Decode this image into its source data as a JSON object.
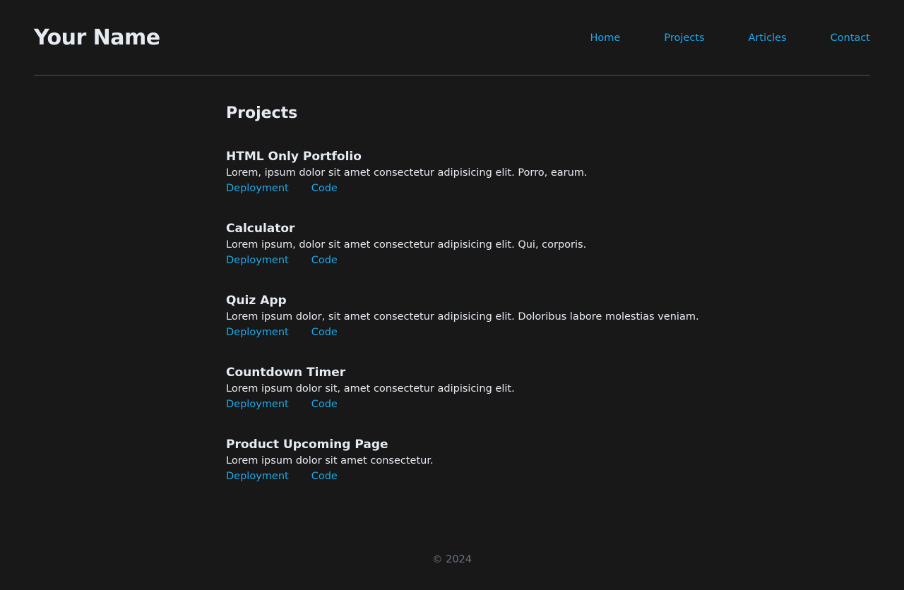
{
  "header": {
    "title": "Your Name",
    "nav": [
      "Home",
      "Projects",
      "Articles",
      "Contact"
    ]
  },
  "main": {
    "section_title": "Projects",
    "projects": [
      {
        "name": "HTML Only Portfolio",
        "description": "Lorem, ipsum dolor sit amet consectetur adipisicing elit. Porro, earum.",
        "links": [
          "Deployment",
          "Code"
        ]
      },
      {
        "name": "Calculator",
        "description": "Lorem ipsum, dolor sit amet consectetur adipisicing elit. Qui, corporis.",
        "links": [
          "Deployment",
          "Code"
        ]
      },
      {
        "name": "Quiz App",
        "description": "Lorem ipsum dolor, sit amet consectetur adipisicing elit. Doloribus labore molestias veniam.",
        "links": [
          "Deployment",
          "Code"
        ]
      },
      {
        "name": "Countdown Timer",
        "description": "Lorem ipsum dolor sit, amet consectetur adipisicing elit.",
        "links": [
          "Deployment",
          "Code"
        ]
      },
      {
        "name": "Product Upcoming Page",
        "description": "Lorem ipsum dolor sit amet consectetur.",
        "links": [
          "Deployment",
          "Code"
        ]
      }
    ]
  },
  "footer": {
    "copyright": "© 2024"
  },
  "colors": {
    "background": "#181818",
    "text": "#e6ebf2",
    "link": "#1ea7e8",
    "divider": "#4a5260",
    "muted": "#6a7484"
  }
}
